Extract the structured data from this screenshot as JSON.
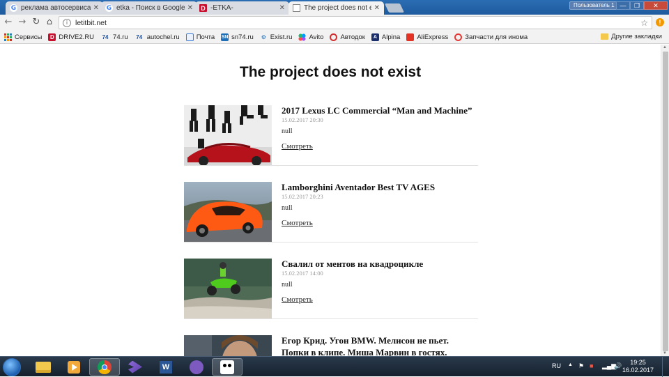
{
  "browser": {
    "tabs": [
      {
        "label": "реклама автосервиса та",
        "icon": "G"
      },
      {
        "label": "etka - Поиск в Google",
        "icon": "G"
      },
      {
        "label": "-ETKA-",
        "icon": "D"
      },
      {
        "label": "The project does not exi",
        "icon": ""
      }
    ],
    "user_button": "Пользователь 1",
    "window_controls": {
      "minimize": "—",
      "restore": "❐",
      "close": "✕"
    },
    "nav": {
      "back": "←",
      "forward": "→",
      "reload": "↻",
      "home": "⌂"
    },
    "url": "letitbit.net",
    "info_glyph": "i",
    "star_glyph": "☆",
    "extension_badge": "!"
  },
  "bookmarks": {
    "items": [
      {
        "label": "Сервисы",
        "icon": "apps"
      },
      {
        "label": "DRIVE2.RU",
        "icon": "D"
      },
      {
        "label": "74.ru",
        "icon": "74"
      },
      {
        "label": "autochel.ru",
        "icon": "74"
      },
      {
        "label": "Почта",
        "icon": "mail"
      },
      {
        "label": "sn74.ru",
        "icon": "sn"
      },
      {
        "label": "Exist.ru",
        "icon": "ex"
      },
      {
        "label": "Avito",
        "icon": "av"
      },
      {
        "label": "Автодок",
        "icon": "ad"
      },
      {
        "label": "Alpina",
        "icon": "al"
      },
      {
        "label": "AliExpress",
        "icon": "ali"
      },
      {
        "label": "Запчасти для инома",
        "icon": "zp"
      }
    ],
    "other": "Другие закладки"
  },
  "page": {
    "title": "The project does not exist",
    "posts": [
      {
        "title": "2017 Lexus LC Commercial “Man and Machine”",
        "date": "15.02.2017 20:30",
        "text": "null",
        "link": "Смотреть"
      },
      {
        "title": "Lamborghini Aventador Best TV AGES",
        "date": "15.02.2017 20:23",
        "text": "null",
        "link": "Смотреть"
      },
      {
        "title": "Свалил от ментов на квадроцикле",
        "date": "15.02.2017 14:00",
        "text": "null",
        "link": "Смотреть"
      },
      {
        "title": "Егор Крид. Угон BMW. Мелисон не пьет. Попки в клипе. Миша Марвин в гостях.",
        "date": "",
        "text": "",
        "link": ""
      }
    ]
  },
  "taskbar": {
    "lang": "RU",
    "time": "19:25",
    "date": "16.02.2017"
  },
  "colors": {
    "titlebar": "#1f5fa6",
    "page_bg": "#ffffff",
    "date_gray": "#9a9a9a"
  }
}
